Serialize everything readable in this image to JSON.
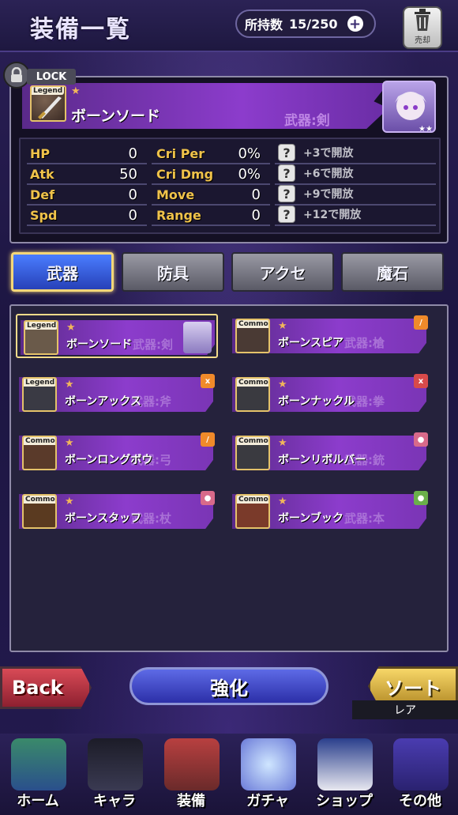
{
  "header": {
    "title": "装備一覧",
    "owned_label": "所持数",
    "owned_value": "15/250",
    "trash_label": "売却"
  },
  "detail": {
    "lock_label": "LOCK",
    "rarity": "Legend",
    "name": "ボーンソード",
    "category": "武器:剣",
    "stats_left": [
      {
        "label": "HP",
        "value": "0"
      },
      {
        "label": "Atk",
        "value": "50"
      },
      {
        "label": "Def",
        "value": "0"
      },
      {
        "label": "Spd",
        "value": "0"
      }
    ],
    "stats_mid": [
      {
        "label": "Cri Per",
        "value": "0%"
      },
      {
        "label": "Cri Dmg",
        "value": "0%"
      },
      {
        "label": "Move",
        "value": "0"
      },
      {
        "label": "Range",
        "value": "0"
      }
    ],
    "unlocks": [
      "+3で開放",
      "+6で開放",
      "+9で開放",
      "+12で開放"
    ]
  },
  "tabs": [
    "武器",
    "防具",
    "アクセ",
    "魔石"
  ],
  "items": [
    {
      "rarity": "Legend",
      "name": "ボーンソード",
      "category": "武器:剣",
      "selected": true
    },
    {
      "rarity": "Common",
      "name": "ボーンスピア",
      "category": "武器:槍"
    },
    {
      "rarity": "Legend",
      "name": "ボーンアックス",
      "category": "武器:斧"
    },
    {
      "rarity": "Common",
      "name": "ボーンナックル",
      "category": "武器:拳"
    },
    {
      "rarity": "Common",
      "name": "ボーンロングボウ",
      "category": "武器:弓"
    },
    {
      "rarity": "Common",
      "name": "ボーンリボルバー",
      "category": "武器:銃"
    },
    {
      "rarity": "Common",
      "name": "ボーンスタッフ",
      "category": "武器:杖"
    },
    {
      "rarity": "Common",
      "name": "ボーンブック",
      "category": "武器:本"
    }
  ],
  "buttons": {
    "back": "Back",
    "enhance": "強化",
    "sort": "ソート",
    "sort_sub": "レア"
  },
  "nav": [
    "ホーム",
    "キャラ",
    "装備",
    "ガチャ",
    "ショップ",
    "その他"
  ],
  "colors": {
    "accent_purple": "#8c3ccc",
    "tab_active": "#2741b8",
    "gold": "#f0c34a"
  }
}
